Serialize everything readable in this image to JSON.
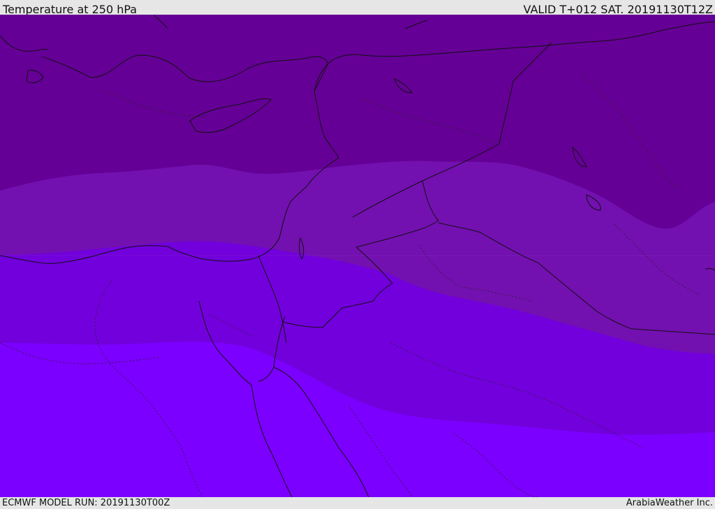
{
  "header": {
    "title": "Temperature at 250 hPa",
    "valid": "VALID T+012 SAT. 20191130T12Z"
  },
  "footer": {
    "model_run": "ECMWF MODEL RUN: 20191130T00Z",
    "credit": "ArabiaWeather Inc."
  },
  "map": {
    "bands": [
      {
        "name": "coldest-band",
        "color": "#650096"
      },
      {
        "name": "cold-band",
        "color": "#7310b0"
      },
      {
        "name": "mid-band",
        "color": "#7200dc"
      },
      {
        "name": "warm-band",
        "color": "#7c00ff"
      }
    ],
    "line_color": "#111111"
  }
}
